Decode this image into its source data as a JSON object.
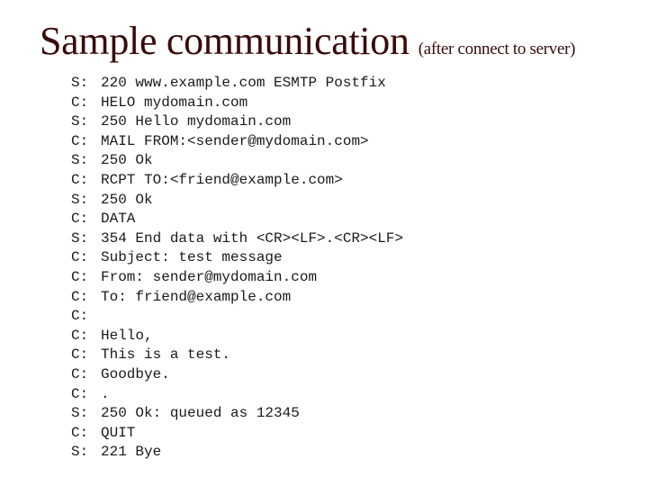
{
  "slide": {
    "title": "Sample communication",
    "subtitle": "(after connect to server)",
    "title_color": "#3a0a0a",
    "lines": [
      {
        "speaker": "S:",
        "text": "220 www.example.com ESMTP Postfix"
      },
      {
        "speaker": "C:",
        "text": "HELO mydomain.com"
      },
      {
        "speaker": "S:",
        "text": "250 Hello mydomain.com"
      },
      {
        "speaker": "C:",
        "text": "MAIL FROM:<sender@mydomain.com>"
      },
      {
        "speaker": "S:",
        "text": "250 Ok"
      },
      {
        "speaker": "C:",
        "text": "RCPT TO:<friend@example.com>"
      },
      {
        "speaker": "S:",
        "text": "250 Ok"
      },
      {
        "speaker": "C:",
        "text": "DATA"
      },
      {
        "speaker": "S:",
        "text": "354 End data with <CR><LF>.<CR><LF>"
      },
      {
        "speaker": "C:",
        "text": "Subject: test message"
      },
      {
        "speaker": "C:",
        "text": "From: sender@mydomain.com"
      },
      {
        "speaker": "C:",
        "text": "To: friend@example.com"
      },
      {
        "speaker": "C:",
        "text": ""
      },
      {
        "speaker": "C:",
        "text": "Hello,"
      },
      {
        "speaker": "C:",
        "text": "This is a test."
      },
      {
        "speaker": "C:",
        "text": "Goodbye."
      },
      {
        "speaker": "C:",
        "text": "."
      },
      {
        "speaker": "S:",
        "text": "250 Ok: queued as 12345"
      },
      {
        "speaker": "C:",
        "text": "QUIT"
      },
      {
        "speaker": "S:",
        "text": "221 Bye"
      }
    ]
  }
}
